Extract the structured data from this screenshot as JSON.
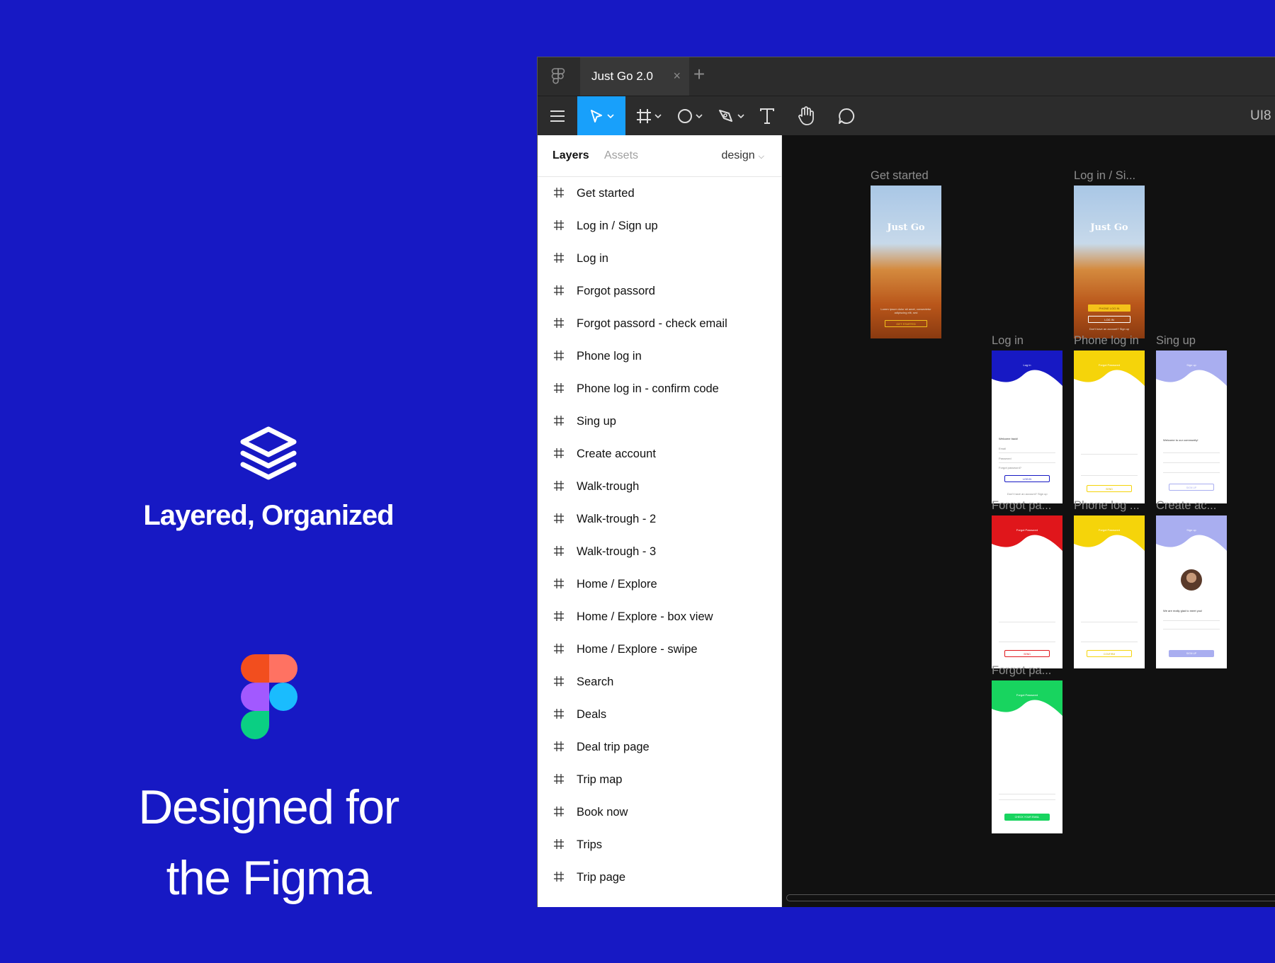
{
  "promo": {
    "headline_1": "Layered, Organized",
    "headline_2_line1": "Designed for",
    "headline_2_line2": "the Figma"
  },
  "window": {
    "tab_title": "Just Go 2.0",
    "tab_close": "×",
    "new_tab": "+",
    "toolbar_right_text": "UI8",
    "tools": [
      "menu-icon",
      "move-icon",
      "frame-icon",
      "ellipse-icon",
      "pen-icon",
      "text-icon",
      "hand-icon",
      "comment-icon"
    ]
  },
  "panel": {
    "tab_layers": "Layers",
    "tab_assets": "Assets",
    "page_name": "design",
    "layers": [
      "Get started",
      "Log in / Sign up",
      "Log in",
      "Forgot passord",
      "Forgot passord - check email",
      "Phone log in",
      "Phone log in - confirm code",
      "Sing up",
      "Create account",
      "Walk-trough",
      "Walk-trough - 2",
      "Walk-trough - 3",
      "Home / Explore",
      "Home / Explore - box view",
      "Home / Explore - swipe",
      "Search",
      "Deals",
      "Deal trip page",
      "Trip map",
      "Book now",
      "Trips",
      "Trip page"
    ]
  },
  "canvas": {
    "frames": {
      "get_started": {
        "label": "Get started",
        "brand": "Just Go",
        "tagline": "Lorem ipsum dolor sit amet, consectetur adipiscing elit, sed",
        "button": "GET STARTED"
      },
      "login_signup": {
        "label": "Log in / Si...",
        "brand": "Just Go",
        "button_1": "PHONE LOG IN",
        "button_2": "LOG IN",
        "footer": "Don't have an account? Sign up"
      },
      "login": {
        "label": "Log in",
        "caption": "Log in",
        "welcome": "Welcome back!",
        "field_1": "Email",
        "field_2": "Password",
        "link": "Forgot password?",
        "button": "LOG IN",
        "footer": "Don't have an account? Sign up",
        "color": "#1719c4"
      },
      "phone_login": {
        "label": "Phone log in",
        "caption": "Forgot Password",
        "button": "SEND",
        "color": "#f5d40a"
      },
      "sign_up": {
        "label": "Sing up",
        "caption": "Sign up",
        "welcome": "Welcome to our community!",
        "button": "SIGN UP",
        "color": "#a9aef0"
      },
      "forgot_password": {
        "label": "Forgot pa...",
        "caption": "Forgot Password",
        "button": "SEND",
        "color": "#e0161b"
      },
      "phone_log_confirm": {
        "label": "Phone log ...",
        "caption": "Forgot Password",
        "button": "CONFIRM",
        "color": "#f5d40a"
      },
      "create_account": {
        "label": "Create ac...",
        "caption": "Sign up",
        "welcome": "We are really glad to meet you!",
        "button": "SIGN UP",
        "color": "#a9aef0"
      },
      "forgot_check_email": {
        "label": "Forgot pa...",
        "caption": "Forgot Password",
        "button": "CHECK YOUR EMAIL",
        "color": "#18d45f"
      }
    }
  }
}
